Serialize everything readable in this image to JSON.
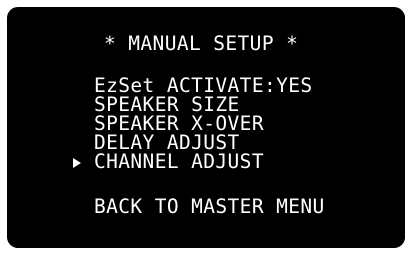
{
  "screen": {
    "title": "* MANUAL SETUP *",
    "menu_items": [
      {
        "label": "EzSet ACTIVATE:YES",
        "selected": false
      },
      {
        "label": "SPEAKER SIZE",
        "selected": false
      },
      {
        "label": "SPEAKER X-OVER",
        "selected": false
      },
      {
        "label": "DELAY ADJUST",
        "selected": false
      },
      {
        "label": "CHANNEL ADJUST",
        "selected": true
      }
    ],
    "back_label": "BACK TO MASTER MENU",
    "cursor_icon": "triangle-right-icon"
  },
  "colors": {
    "background": "#000000",
    "text": "#ffffff",
    "bezel": "#ffffff"
  }
}
